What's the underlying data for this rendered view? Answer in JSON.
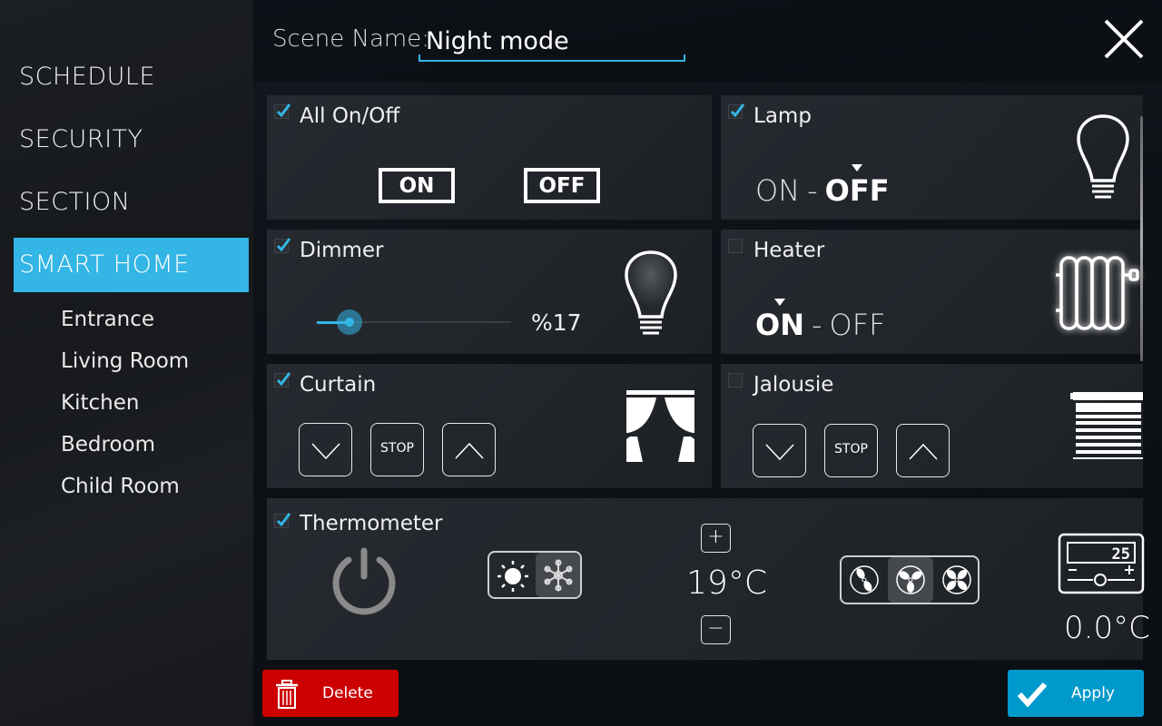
{
  "sidebar": {
    "nav": [
      {
        "label": "SCHEDULE",
        "active": false
      },
      {
        "label": "SECURITY",
        "active": false
      },
      {
        "label": "SECTION",
        "active": false
      },
      {
        "label": "SMART HOME",
        "active": true
      }
    ],
    "rooms": [
      "Entrance",
      "Living Room",
      "Kitchen",
      "Bedroom",
      "Child Room"
    ]
  },
  "header": {
    "scene_label": "Scene Name:",
    "scene_value": "Night mode",
    "close_icon": "close-icon"
  },
  "colors": {
    "accent": "#33b5e5",
    "delete": "#cc0000",
    "apply": "#0099cc"
  },
  "cards": {
    "all": {
      "title": "All On/Off",
      "checked": true,
      "on_label": "ON",
      "off_label": "OFF"
    },
    "lamp": {
      "title": "Lamp",
      "checked": true,
      "on_label": "ON",
      "sep": "-",
      "off_label": "OFF",
      "state": "OFF",
      "icon": "lightbulb-icon"
    },
    "dimmer": {
      "title": "Dimmer",
      "checked": true,
      "value": 17,
      "value_label": "%17",
      "icon": "lightbulb-glow-icon"
    },
    "heater": {
      "title": "Heater",
      "checked": false,
      "on_label": "ON",
      "sep": "-",
      "off_label": "OFF",
      "state": "ON",
      "icon": "radiator-icon"
    },
    "curtain": {
      "title": "Curtain",
      "checked": true,
      "stop_label": "STOP",
      "icon": "curtain-icon"
    },
    "jalousie": {
      "title": "Jalousie",
      "checked": false,
      "stop_label": "STOP",
      "icon": "blinds-icon"
    },
    "thermometer": {
      "title": "Thermometer",
      "checked": true,
      "mode_options": [
        "heat",
        "cool"
      ],
      "mode_selected": "cool",
      "setpoint": "19",
      "unit": "°C",
      "plus_label": "+",
      "minus_label": "−",
      "fan_options": [
        "low",
        "medium",
        "high"
      ],
      "fan_selected": "medium",
      "thermostat_display": "25",
      "current_temp": "0.0",
      "current_unit": "°C"
    }
  },
  "footer": {
    "delete_label": "Delete",
    "apply_label": "Apply"
  }
}
